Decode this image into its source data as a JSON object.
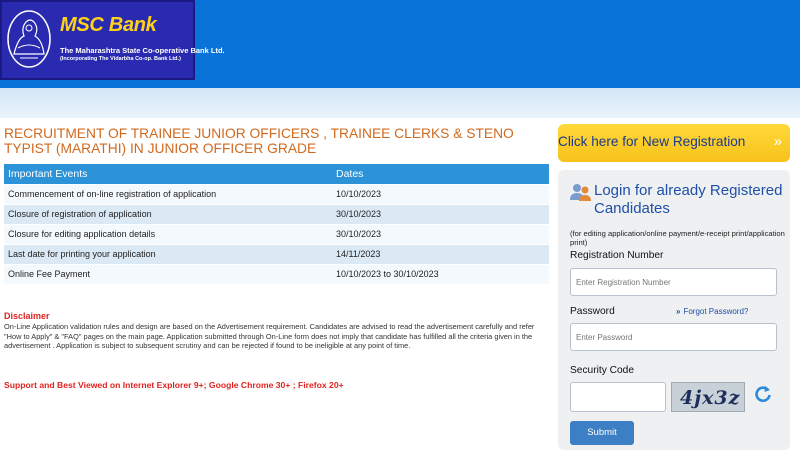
{
  "header": {
    "logo_title": "MSC Bank",
    "logo_sub1": "The Maharashtra State Co-operative Bank Ltd.",
    "logo_sub2": "(Incorporating The Vidarbha Co-op. Bank Ltd.)"
  },
  "main": {
    "heading": "RECRUITMENT OF TRAINEE JUNIOR OFFICERS , TRAINEE CLERKS & STENO TYPIST (MARATHI) IN JUNIOR OFFICER GRADE",
    "table": {
      "headers": [
        "Important Events",
        "Dates"
      ],
      "rows": [
        [
          "Commencement of on-line registration of application",
          "10/10/2023"
        ],
        [
          "Closure of registration of application",
          "30/10/2023"
        ],
        [
          "Closure for editing application details",
          "30/10/2023"
        ],
        [
          "Last date for printing your application",
          "14/11/2023"
        ],
        [
          "Online Fee Payment",
          "10/10/2023 to 30/10/2023"
        ]
      ]
    },
    "disclaimer_title": "Disclaimer",
    "disclaimer_text": "On-Line Application validation rules and design are based on the Advertisement requirement. Candidates are advised to read the advertisement carefully and refer \"How to Apply\" & \"FAQ\" pages on the main page. Application submitted through On-Line form does not imply that candidate has fulfilled all the criteria given in the advertisement . Application is subject to subsequent scrutiny and can be rejected if found to be ineligible at any point of time.",
    "support_text": "Support and Best Viewed on Internet Explorer 9+; Google Chrome 30+ ; Firefox 20+"
  },
  "sidebar": {
    "new_registration_label": "Click here for New Registration",
    "new_registration_arrow": "»",
    "login_title": "Login for already Registered Candidates",
    "login_note": "(for editing application/online payment/e-receipt print/application print)",
    "registration_label": "Registration Number",
    "registration_placeholder": "Enter Registration Number",
    "password_label": "Password",
    "forgot_password": "Forgot Password?",
    "forgot_icon": "»",
    "password_placeholder": "Enter Password",
    "security_label": "Security Code",
    "captcha_text": "4jx3z",
    "submit_label": "Submit"
  },
  "colors": {
    "header_blue": "#0a73d9",
    "heading_orange": "#d2691e",
    "table_header": "#2c93d8",
    "disclaimer_red": "#e0221f",
    "button_yellow": "#f7c21a",
    "link_blue": "#1f4fa8"
  }
}
